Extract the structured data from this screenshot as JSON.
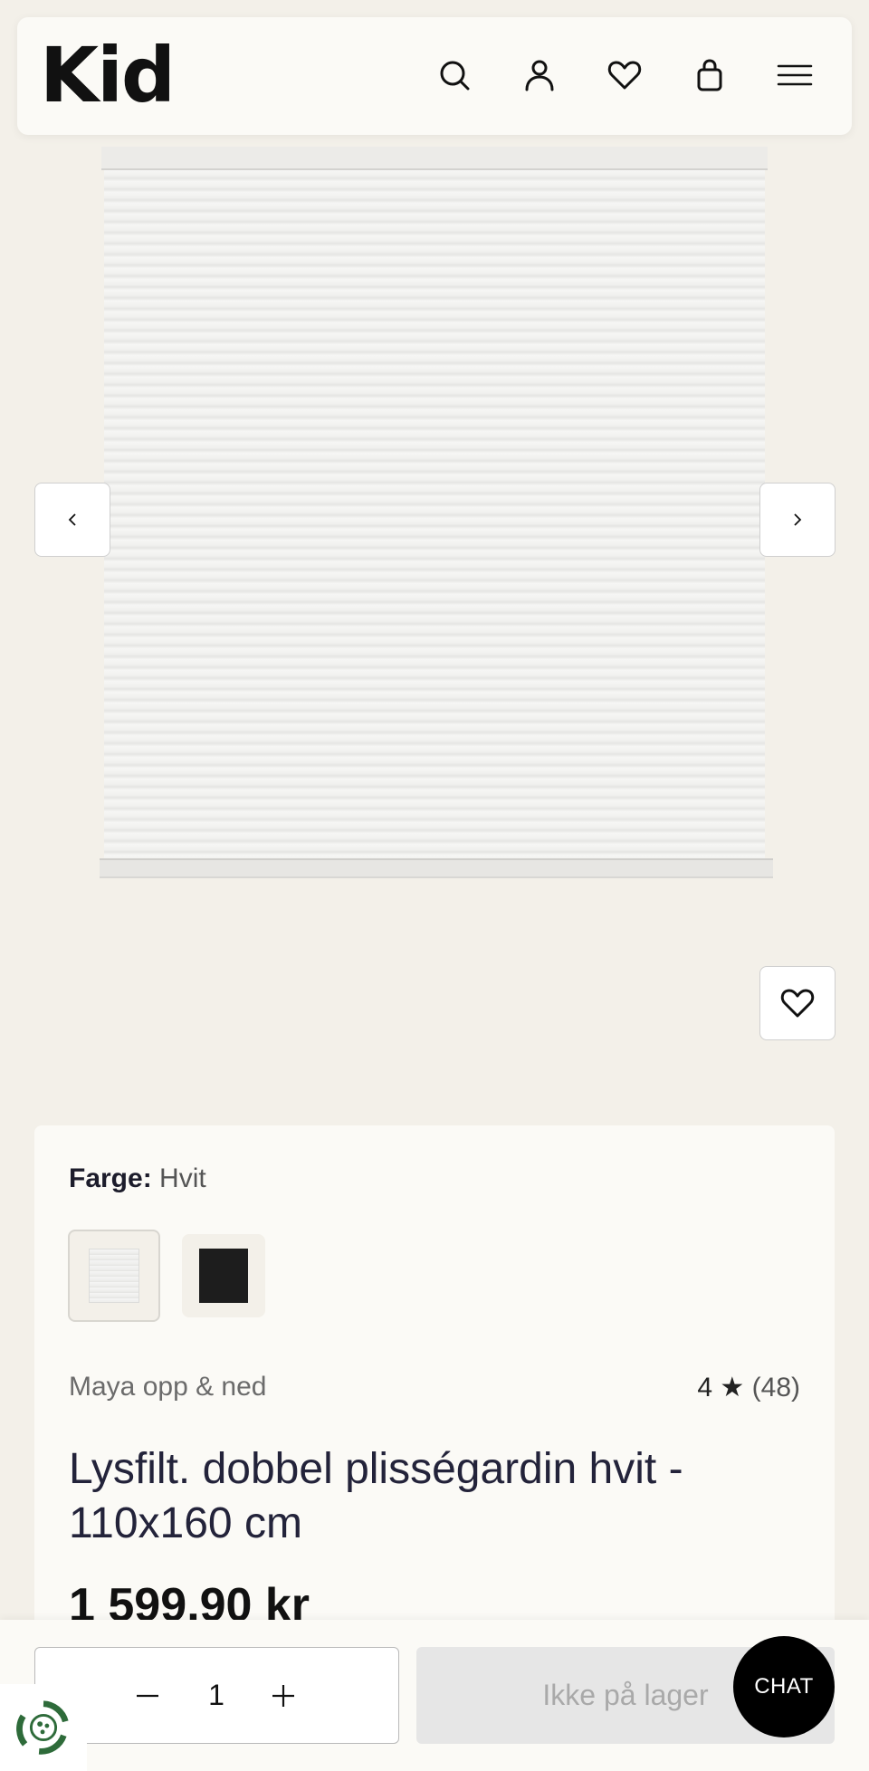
{
  "header": {
    "logo": "Kid",
    "icons": [
      "search-icon",
      "account-icon",
      "heart-icon",
      "bag-icon",
      "menu-icon"
    ]
  },
  "gallery": {
    "image_alt": "Lysfilt. dobbel plisségardin hvit",
    "prev_icon": "chevron-left-icon",
    "next_icon": "chevron-right-icon",
    "favorite_icon": "heart-icon"
  },
  "product": {
    "color_label": "Farge:",
    "color_value": "Hvit",
    "swatches": [
      {
        "name": "Hvit",
        "color": "#f0f0ee",
        "selected": true
      },
      {
        "name": "Svart",
        "color": "#1a1a1a",
        "selected": false
      }
    ],
    "brand": "Maya opp & ned",
    "rating": "4",
    "rating_star": "★",
    "review_count": "(48)",
    "title": "Lysfilt. dobbel plisségardin hvit - 110x160 cm",
    "price": "1 599,90 kr"
  },
  "cart": {
    "quantity": "1",
    "stock_status": "Ikke på lager",
    "chat_label": "CHAT"
  },
  "colors": {
    "background": "#f3f0e9",
    "panel": "#fbfaf6",
    "disabled_button": "#e6e6e6"
  }
}
